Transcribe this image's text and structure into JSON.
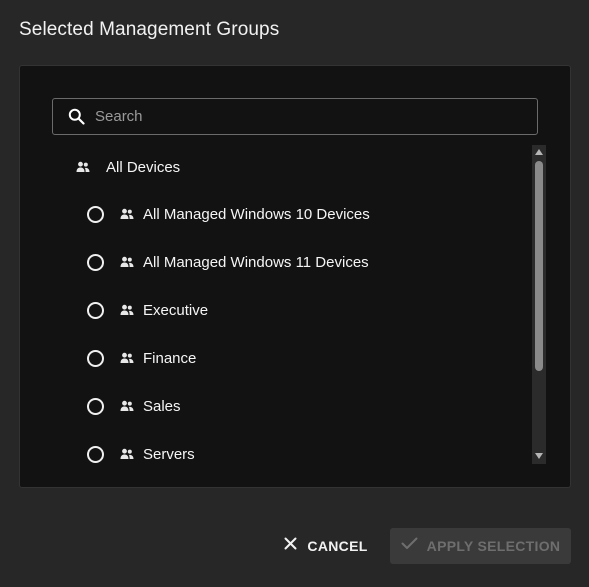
{
  "dialog": {
    "title": "Selected Management Groups"
  },
  "search": {
    "placeholder": "Search",
    "value": ""
  },
  "tree": {
    "root": {
      "label": "All Devices",
      "icon": "group-icon"
    },
    "children": [
      {
        "label": "All Managed Windows 10 Devices",
        "selected": false,
        "icon": "group-icon"
      },
      {
        "label": "All Managed Windows 11 Devices",
        "selected": false,
        "icon": "group-icon"
      },
      {
        "label": "Executive",
        "selected": false,
        "icon": "group-icon"
      },
      {
        "label": "Finance",
        "selected": false,
        "icon": "group-icon"
      },
      {
        "label": "Sales",
        "selected": false,
        "icon": "group-icon"
      },
      {
        "label": "Servers",
        "selected": false,
        "icon": "group-icon"
      }
    ]
  },
  "actions": {
    "cancel_label": "CANCEL",
    "apply_label": "APPLY SELECTION",
    "apply_enabled": false
  },
  "colors": {
    "background": "#272727",
    "panel": "#121212",
    "text": "#f5f5f5",
    "disabled_text": "#6e6e6e"
  }
}
